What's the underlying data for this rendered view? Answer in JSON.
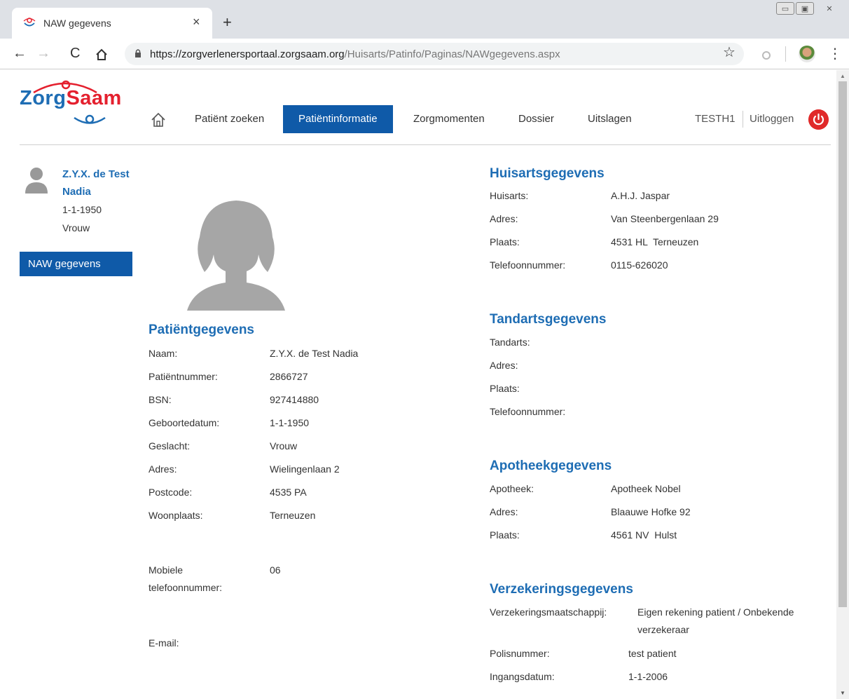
{
  "browser": {
    "tab_title": "NAW gegevens",
    "url_host": "https://zorgverlenersportaal.zorgsaam.org",
    "url_path": "/Huisarts/Patinfo/Paginas/NAWgegevens.aspx"
  },
  "logo": {
    "part1": "Zorg",
    "part2": "Saam"
  },
  "nav": {
    "items": [
      "Patiënt zoeken",
      "Patiëntinformatie",
      "Zorgmomenten",
      "Dossier",
      "Uitslagen"
    ],
    "active": "Patiëntinformatie",
    "user": "TESTH1",
    "logout": "Uitloggen"
  },
  "sidebar": {
    "name_line1": "Z.Y.X. de Test",
    "name_line2": "Nadia",
    "dob": "1-1-1950",
    "gender": "Vrouw",
    "menu_item": "NAW gegevens"
  },
  "patient": {
    "title": "Patiëntgegevens",
    "fields": [
      {
        "label": "Naam:",
        "value": "Z.Y.X. de Test Nadia"
      },
      {
        "label": "Patiëntnummer:",
        "value": "2866727"
      },
      {
        "label": "BSN:",
        "value": "927414880"
      },
      {
        "label": "Geboortedatum:",
        "value": "1-1-1950"
      },
      {
        "label": "Geslacht:",
        "value": "Vrouw"
      },
      {
        "label": "Adres:",
        "value": "Wielingenlaan 2"
      },
      {
        "label": "Postcode:",
        "value": "4535 PA"
      },
      {
        "label": "Woonplaats:",
        "value": "Terneuzen"
      }
    ],
    "mobile_label_1": "Mobiele",
    "mobile_label_2": "telefoonnummer:",
    "mobile_value": "06",
    "email_label": "E-mail:"
  },
  "huisarts": {
    "title": "Huisartsgegevens",
    "fields": [
      {
        "label": "Huisarts:",
        "value": "A.H.J. Jaspar"
      },
      {
        "label": "Adres:",
        "value": "Van Steenbergenlaan 29"
      },
      {
        "label": "Plaats:",
        "value": "4531 HL  Terneuzen"
      },
      {
        "label": "Telefoonnummer:",
        "value": "0115-626020"
      }
    ]
  },
  "tandarts": {
    "title": "Tandartsgegevens",
    "fields": [
      {
        "label": "Tandarts:",
        "value": ""
      },
      {
        "label": "Adres:",
        "value": ""
      },
      {
        "label": "Plaats:",
        "value": ""
      },
      {
        "label": "Telefoonnummer:",
        "value": ""
      }
    ]
  },
  "apotheek": {
    "title": "Apotheekgegevens",
    "fields": [
      {
        "label": "Apotheek:",
        "value": "Apotheek Nobel"
      },
      {
        "label": "Adres:",
        "value": "Blaauwe Hofke 92"
      },
      {
        "label": "Plaats:",
        "value": "4561 NV  Hulst"
      }
    ]
  },
  "verzekering": {
    "title": "Verzekeringsgegevens",
    "maatschappij_label": "Verzekeringsmaatschappij:",
    "maatschappij_value_1": "Eigen rekening patient / Onbekende",
    "maatschappij_value_2": "verzekeraar",
    "polis_label": "Polisnummer:",
    "polis_value": "test patient",
    "ingang_label": "Ingangsdatum:",
    "ingang_value": "1-1-2006"
  },
  "colors": {
    "brand_blue": "#1e6db4",
    "active_blue": "#0f5aa8",
    "brand_red": "#e4202e"
  }
}
